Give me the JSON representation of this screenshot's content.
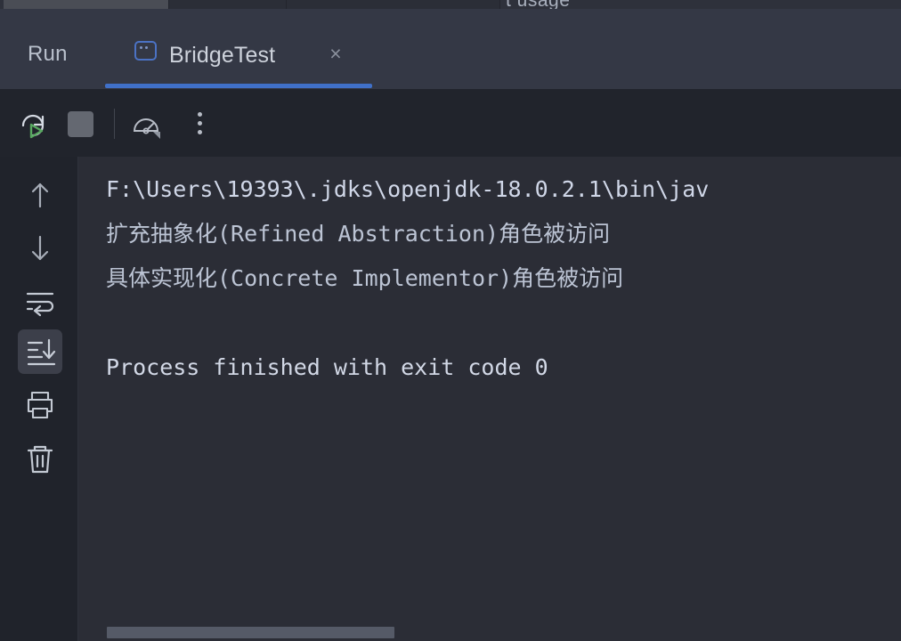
{
  "window": {
    "top_strip_partial_text": "t usage"
  },
  "tabstrip": {
    "run_label": "Run",
    "active_tab": {
      "title": "BridgeTest",
      "icon": "console-tab-icon",
      "close_label": "×"
    },
    "accent_color": "#4070c8"
  },
  "toolbar": {
    "buttons": [
      {
        "name": "rerun-button",
        "tooltip": "Rerun"
      },
      {
        "name": "stop-button",
        "tooltip": "Stop"
      },
      {
        "name": "profiler-button",
        "tooltip": "Profiler"
      },
      {
        "name": "more-options-button",
        "tooltip": "More Options"
      }
    ]
  },
  "gutter": {
    "items": [
      {
        "name": "scroll-up-button",
        "icon": "arrow-up-icon",
        "selected": false
      },
      {
        "name": "scroll-down-button",
        "icon": "arrow-down-icon",
        "selected": false
      },
      {
        "name": "soft-wrap-button",
        "icon": "soft-wrap-icon",
        "selected": false
      },
      {
        "name": "scroll-to-end-button",
        "icon": "scroll-to-end-icon",
        "selected": true
      },
      {
        "name": "print-button",
        "icon": "printer-icon",
        "selected": false
      },
      {
        "name": "clear-all-button",
        "icon": "trash-icon",
        "selected": false
      }
    ]
  },
  "console": {
    "lines": [
      {
        "kind": "path",
        "text": "F:\\Users\\19393\\.jdks\\openjdk-18.0.2.1\\bin\\jav"
      },
      {
        "kind": "out",
        "text": "扩充抽象化(Refined Abstraction)角色被访问"
      },
      {
        "kind": "out",
        "text": "具体实现化(Concrete Implementor)角色被访问"
      },
      {
        "kind": "blank",
        "text": ""
      },
      {
        "kind": "exit",
        "text": "Process finished with exit code 0"
      }
    ],
    "scrollbar": {
      "name": "horizontal-scrollbar"
    }
  },
  "colors": {
    "console_bg": "#2b2d36",
    "toolbar_bg": "#21242c",
    "tabstrip_bg": "#343845",
    "gutter_bg": "#20232b",
    "accent_blue": "#4070c8",
    "run_green": "#58a860",
    "text_primary": "#ced3dc"
  }
}
